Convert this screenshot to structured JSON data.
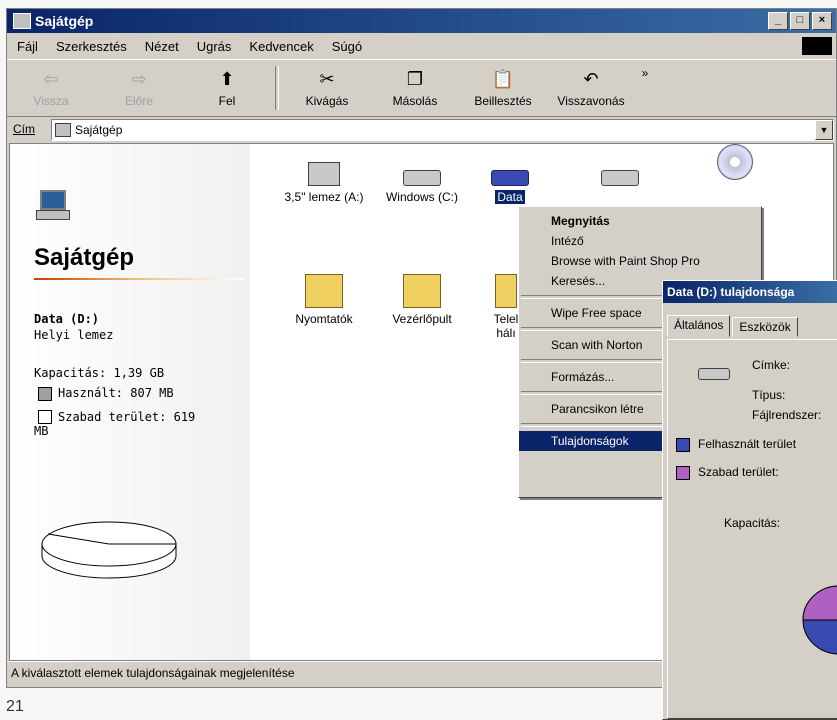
{
  "window": {
    "title": "Sajátgép"
  },
  "menu": [
    "Fájl",
    "Szerkesztés",
    "Nézet",
    "Ugrás",
    "Kedvencek",
    "Súgó"
  ],
  "toolbar": {
    "back": "Vissza",
    "forward": "Előre",
    "up": "Fel",
    "cut": "Kivágás",
    "copy": "Másolás",
    "paste": "Beillesztés",
    "undo": "Visszavonás",
    "more": "»"
  },
  "address": {
    "label": "Cím",
    "value": "Sajátgép"
  },
  "panel": {
    "title": "Sajátgép",
    "drive_name": "Data (D:)",
    "drive_type": "Helyi lemez",
    "capacity": "Kapacitás: 1,39 GB",
    "used": "Használt: 807 MB",
    "free": "Szabad terület: 619 MB"
  },
  "icons": {
    "floppy": "3,5\" lemez (A:)",
    "windows": "Windows (C:)",
    "data": "Data",
    "printers": "Nyomtatók",
    "control": "Vezérlőpult",
    "telnet1": "Telel",
    "telnet2": "hálı"
  },
  "context_menu": {
    "open": "Megnyitás",
    "explore": "Intéző",
    "paintshop": "Browse with Paint Shop Pro",
    "search": "Keresés...",
    "wipe": "Wipe Free space",
    "scan": "Scan with Norton",
    "format": "Formázás...",
    "shortcut": "Parancsikon létre",
    "properties": "Tulajdonságok"
  },
  "dialog": {
    "title": "Data (D:) tulajdonsága",
    "tab_general": "Általános",
    "tab_tools": "Eszközök",
    "label": "Címke:",
    "type": "Típus:",
    "fs": "Fájlrendszer:",
    "used": "Felhasznált terület",
    "free": "Szabad terület:",
    "capacity": "Kapacitás:"
  },
  "status": "A kiválasztott elemek tulajdonságainak megjelenítése",
  "page_number": "21"
}
